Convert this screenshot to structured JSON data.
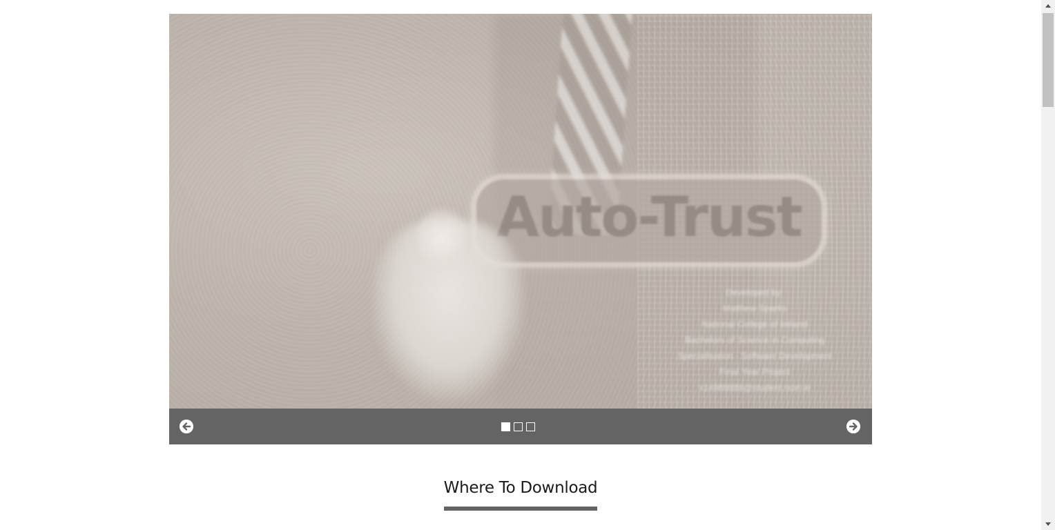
{
  "slideshow": {
    "slide": {
      "logo_text": "Auto-Trust",
      "credits": [
        "Developed by:",
        "Matthew Sparks",
        "National College of Ireland",
        "Bachelors of Science in Computing",
        "Specialisation - Software Development",
        "Final Year Project",
        "x14988888@student.ncirl.ie"
      ]
    },
    "controls": {
      "prev_icon": "arrow-circle-left-icon",
      "next_icon": "arrow-circle-right-icon",
      "dots_count": 3,
      "active_dot": 1
    }
  },
  "section": {
    "heading": "Where To Download"
  },
  "colors": {
    "control_bar": "#646464",
    "heading_underline": "#646464",
    "scrollbar_track": "#f1f1f1",
    "scrollbar_thumb": "#c1c1c1"
  }
}
